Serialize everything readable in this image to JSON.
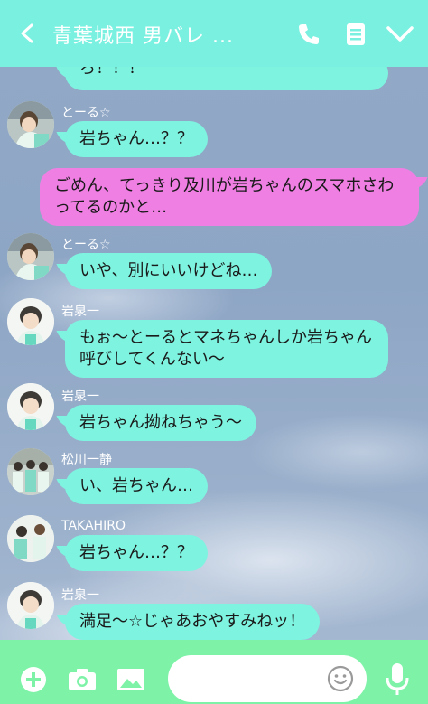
{
  "header": {
    "title": "青葉城西 男バレ ...",
    "back_icon": "chevron-left-icon",
    "call_icon": "phone-icon",
    "notes_icon": "notes-icon",
    "menu_icon": "chevron-down-icon",
    "color": "#7af0e0"
  },
  "messages": [
    {
      "side": "left",
      "sender": "",
      "text": "ろ！！！"
    },
    {
      "side": "left",
      "sender": "とーる☆",
      "text": "岩ちゃん…？？"
    },
    {
      "side": "right",
      "sender": "",
      "text": "ごめん、てっきり及川が岩ちゃんのスマホさわってるのかと…"
    },
    {
      "side": "left",
      "sender": "とーる☆",
      "text": "いや、別にいいけどね…"
    },
    {
      "side": "left",
      "sender": "岩泉一",
      "text": "もぉ～とーるとマネちゃんしか岩ちゃん呼びしてくんない～"
    },
    {
      "side": "left",
      "sender": "岩泉一",
      "text": "岩ちゃん拗ねちゃう～"
    },
    {
      "side": "left",
      "sender": "松川一静",
      "text": "い、岩ちゃん…"
    },
    {
      "side": "left",
      "sender": "TAKAHIRO",
      "text": "岩ちゃん…？？"
    },
    {
      "side": "left",
      "sender": "岩泉一",
      "text": "満足～☆じゃあおやすみねッ！"
    }
  ],
  "footer": {
    "input_value": "",
    "color": "#7ef3a8",
    "icons": [
      "plus-icon",
      "camera-icon",
      "image-icon",
      "smile-icon",
      "microphone-icon"
    ]
  },
  "colors": {
    "left_bubble": "#7ef3e0",
    "right_bubble": "#f07fe4"
  }
}
